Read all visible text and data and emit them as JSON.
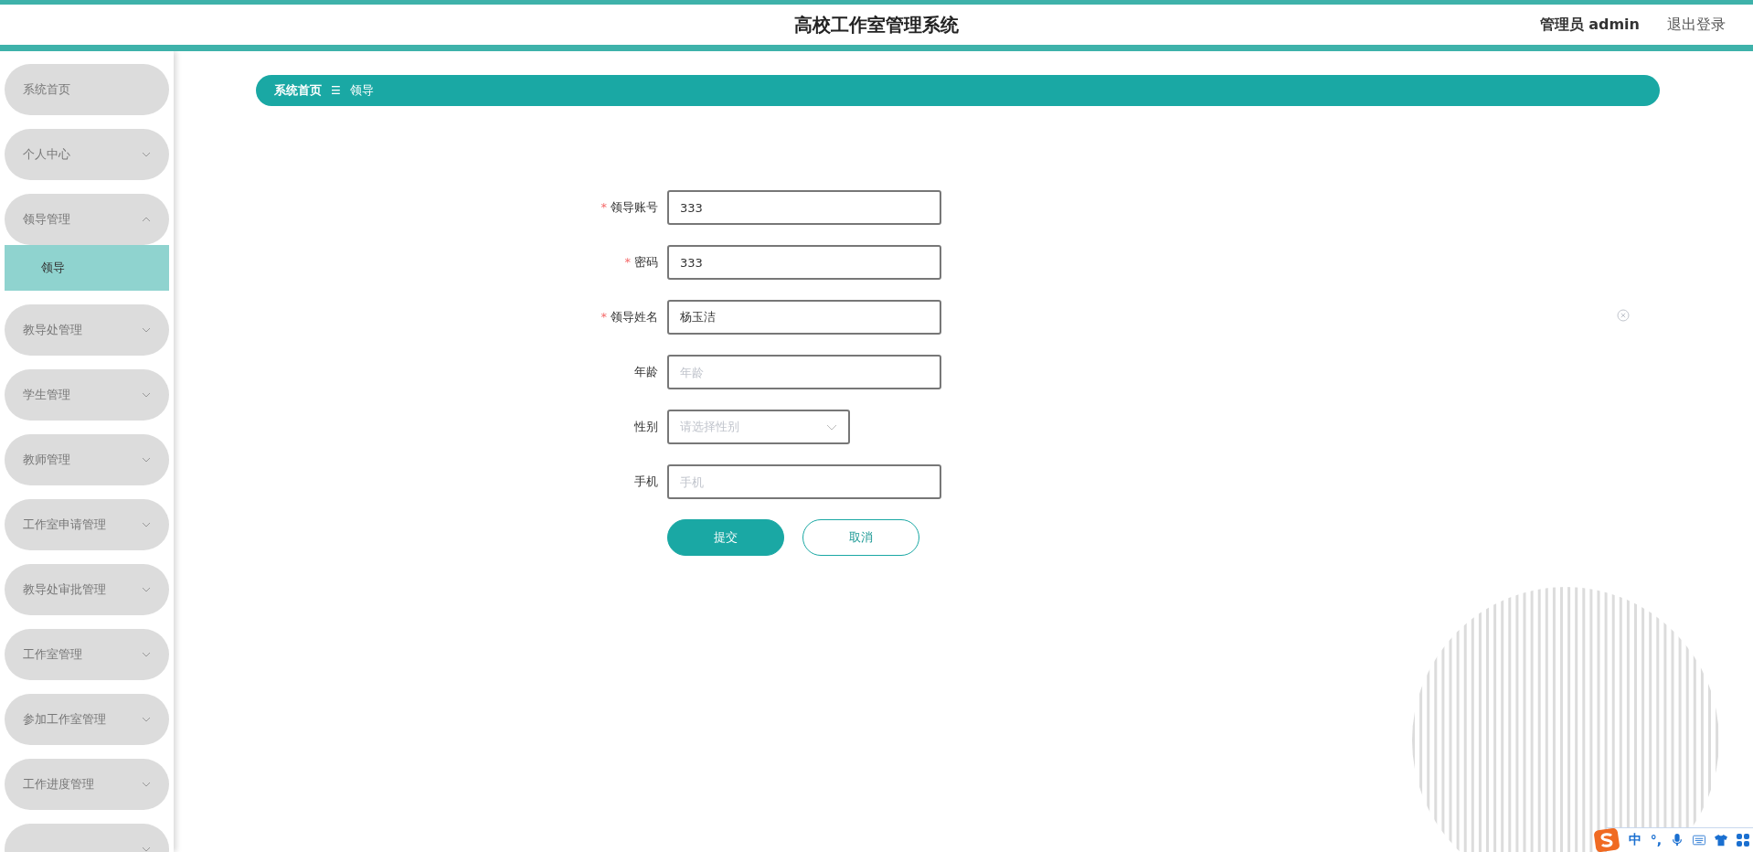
{
  "header": {
    "title": "高校工作室管理系统",
    "user": "管理员 admin",
    "logout": "退出登录"
  },
  "sidebar": {
    "items": [
      {
        "label": "系统首页",
        "kind": "link"
      },
      {
        "label": "个人中心",
        "kind": "group",
        "expanded": false
      },
      {
        "label": "领导管理",
        "kind": "group",
        "expanded": true,
        "children": [
          {
            "label": "领导",
            "selected": true
          }
        ]
      },
      {
        "label": "教导处管理",
        "kind": "group",
        "expanded": false
      },
      {
        "label": "学生管理",
        "kind": "group",
        "expanded": false
      },
      {
        "label": "教师管理",
        "kind": "group",
        "expanded": false
      },
      {
        "label": "工作室申请管理",
        "kind": "group",
        "expanded": false
      },
      {
        "label": "教导处审批管理",
        "kind": "group",
        "expanded": false
      },
      {
        "label": "工作室管理",
        "kind": "group",
        "expanded": false
      },
      {
        "label": "参加工作室管理",
        "kind": "group",
        "expanded": false
      },
      {
        "label": "工作进度管理",
        "kind": "group",
        "expanded": false
      },
      {
        "kind": "group",
        "expanded": false
      }
    ]
  },
  "breadcrumb": {
    "items": [
      "系统首页",
      "领导"
    ],
    "separator": "☰"
  },
  "form": {
    "required_mark": "*",
    "fields": [
      {
        "label": "领导账号",
        "required": true,
        "kind": "input",
        "value": "333"
      },
      {
        "label": "密码",
        "required": true,
        "kind": "input",
        "value": "333"
      },
      {
        "label": "领导姓名",
        "required": true,
        "kind": "input",
        "value": "杨玉洁"
      },
      {
        "label": "年龄",
        "required": false,
        "kind": "input",
        "placeholder": "年龄"
      },
      {
        "label": "性别",
        "required": false,
        "kind": "select",
        "placeholder": "请选择性别"
      },
      {
        "label": "手机",
        "required": false,
        "kind": "input",
        "placeholder": "手机"
      }
    ],
    "buttons": [
      {
        "label": "提交",
        "kind": "primary"
      },
      {
        "label": "取消",
        "kind": "plain"
      }
    ]
  },
  "ime_bar": {
    "items": [
      "中",
      "°,"
    ]
  }
}
